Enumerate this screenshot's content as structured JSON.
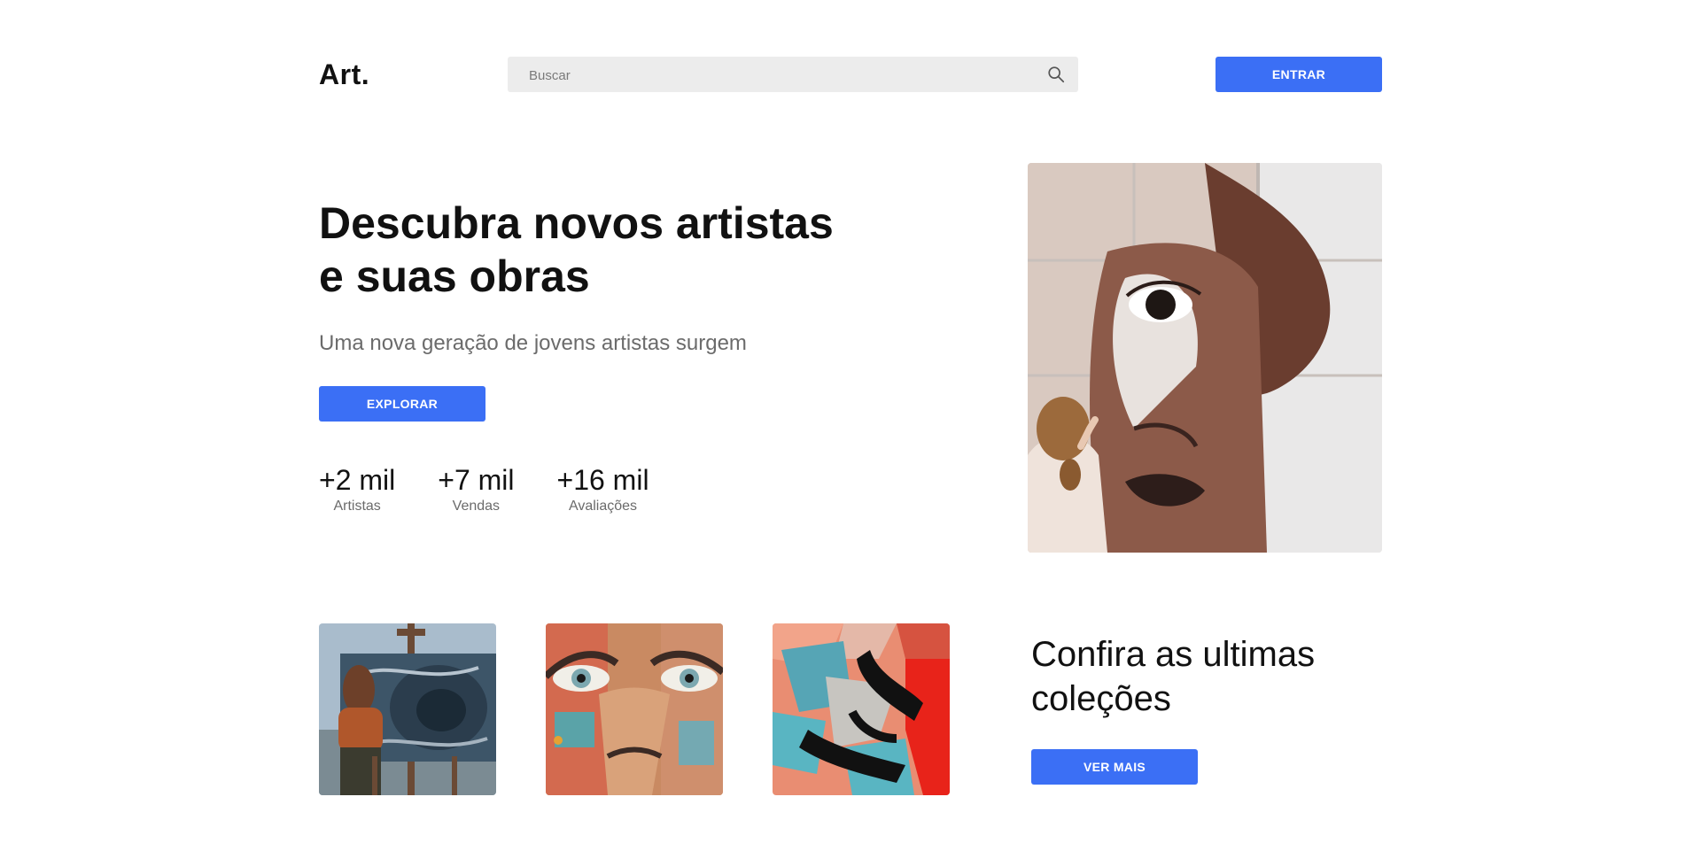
{
  "header": {
    "logo": "Art.",
    "search_placeholder": "Buscar",
    "login_label": "ENTRAR"
  },
  "hero": {
    "title_line1": "Descubra novos artistas",
    "title_line2": "e suas obras",
    "subtitle": "Uma nova geração de jovens artistas surgem",
    "explore_label": "EXPLORAR",
    "stats": [
      {
        "value": "+2 mil",
        "label": "Artistas"
      },
      {
        "value": "+7 mil",
        "label": "Vendas"
      },
      {
        "value": "+16 mil",
        "label": "Avaliações"
      }
    ]
  },
  "collections": {
    "title_line1": "Confira as ultimas",
    "title_line2": "coleções",
    "more_label": "VER MAIS"
  },
  "colors": {
    "accent": "#3b6ff5",
    "search_bg": "#ececec",
    "muted_text": "#6b6b6b"
  }
}
